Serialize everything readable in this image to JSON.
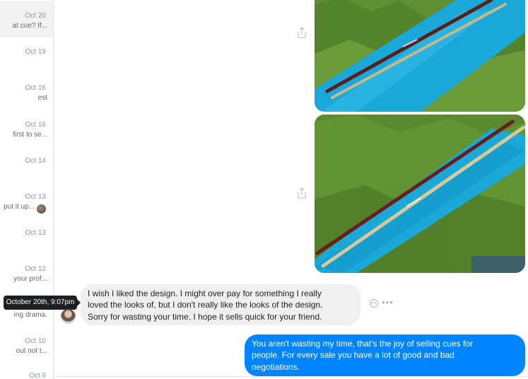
{
  "sidebar": {
    "items": [
      {
        "date": "Oct 20",
        "snippet": "at cue? If...",
        "active": true
      },
      {
        "date": "Oct 19",
        "snippet": ""
      },
      {
        "date": "Oct 16",
        "snippet": "est"
      },
      {
        "date": "Oct 16",
        "snippet": "first to se..."
      },
      {
        "date": "Oct 14",
        "snippet": ""
      },
      {
        "date": "Oct 13",
        "snippet": "put it up..."
      },
      {
        "date": "Oct 13",
        "snippet": ""
      },
      {
        "date": "Oct 12",
        "snippet": "your prof..."
      },
      {
        "date": "",
        "snippet": "ing drama."
      },
      {
        "date": "Oct 10",
        "snippet": "out not t..."
      },
      {
        "date": "Oct 9",
        "snippet": ""
      }
    ]
  },
  "tooltip": {
    "text": "October 20th, 9:07pm"
  },
  "incoming_message": {
    "lines": [
      "I wish I liked the design. I might over pay for something I really",
      "loved the looks of, but I don't really like the looks of the design.",
      "Sorry for wasting your time. I hope it sells quick for your friend."
    ]
  },
  "outgoing_message": {
    "lines": [
      "You aren't wasting my time, that's the joy of selling cues for",
      "people.  For every sale you have a lot of good and bad",
      "negotiations."
    ]
  },
  "icons": {
    "share": "share-icon",
    "emoji": "emoji-icon",
    "more": "more-options-icon"
  },
  "colors": {
    "outgoing_bubble": "#0084ff",
    "incoming_bubble": "#f1f0f0",
    "cloth": "#1aa8d8"
  }
}
